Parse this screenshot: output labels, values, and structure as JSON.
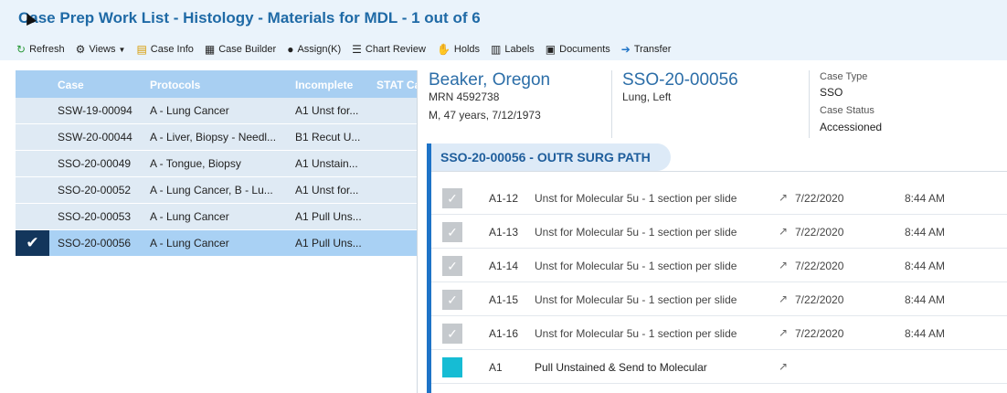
{
  "window": {
    "title": "Case Prep Work List - Histology - Materials for MDL - 1 out of 6"
  },
  "toolbar": {
    "items": [
      {
        "label": "Refresh",
        "icon": "refresh-icon"
      },
      {
        "label": "Views",
        "icon": "views-icon"
      },
      {
        "label": "Case Info",
        "icon": "case-info-icon"
      },
      {
        "label": "Case Builder",
        "icon": "case-builder-icon"
      },
      {
        "label": "Assign(K)",
        "icon": "assign-icon"
      },
      {
        "label": "Chart Review",
        "icon": "chart-review-icon"
      },
      {
        "label": "Holds",
        "icon": "holds-icon"
      },
      {
        "label": "Labels",
        "icon": "labels-icon"
      },
      {
        "label": "Documents",
        "icon": "documents-icon"
      },
      {
        "label": "Transfer",
        "icon": "transfer-arrow-icon"
      }
    ]
  },
  "worklist": {
    "columns": [
      "Case",
      "Protocols",
      "Incomplete",
      "STAT Ca"
    ],
    "rows": [
      {
        "case": "SSW-19-00094",
        "protocols": "A - Lung Cancer",
        "incomplete": "A1 Unst for...",
        "selected": false
      },
      {
        "case": "SSW-20-00044",
        "protocols": "A - Liver, Biopsy - Needl...",
        "incomplete": "B1 Recut U...",
        "selected": false
      },
      {
        "case": "SSO-20-00049",
        "protocols": "A - Tongue, Biopsy",
        "incomplete": "A1 Unstain...",
        "selected": false
      },
      {
        "case": "SSO-20-00052",
        "protocols": "A - Lung Cancer, B - Lu...",
        "incomplete": "A1 Unst for...",
        "selected": false
      },
      {
        "case": "SSO-20-00053",
        "protocols": "A - Lung Cancer",
        "incomplete": "A1 Pull Uns...",
        "selected": false
      },
      {
        "case": "SSO-20-00056",
        "protocols": "A - Lung Cancer",
        "incomplete": "A1 Pull Uns...",
        "selected": true
      }
    ]
  },
  "patient": {
    "name": "Beaker, Oregon",
    "mrn": "MRN 4592738",
    "demographics": "M, 47 years, 7/12/1973",
    "case_number": "SSO-20-00056",
    "site": "Lung, Left",
    "case_type_label": "Case Type",
    "case_type": "SSO",
    "case_status_label": "Case Status",
    "case_status": "Accessioned"
  },
  "section": {
    "title": "SSO-20-00056 - OUTR SURG PATH",
    "items": [
      {
        "code": "A1-12",
        "description": "Unst for Molecular 5u - 1 section per slide",
        "date": "7/22/2020",
        "time": "8:44 AM",
        "done": true
      },
      {
        "code": "A1-13",
        "description": "Unst for Molecular 5u - 1 section per slide",
        "date": "7/22/2020",
        "time": "8:44 AM",
        "done": true
      },
      {
        "code": "A1-14",
        "description": "Unst for Molecular 5u - 1 section per slide",
        "date": "7/22/2020",
        "time": "8:44 AM",
        "done": true
      },
      {
        "code": "A1-15",
        "description": "Unst for Molecular 5u - 1 section per slide",
        "date": "7/22/2020",
        "time": "8:44 AM",
        "done": true
      },
      {
        "code": "A1-16",
        "description": "Unst for Molecular 5u - 1 section per slide",
        "date": "7/22/2020",
        "time": "8:44 AM",
        "done": true
      },
      {
        "code": "A1",
        "description": "Pull Unstained & Send to Molecular",
        "date": "",
        "time": "",
        "done": false
      }
    ]
  },
  "colors": {
    "accent": "#1f6aa6",
    "header": "#a8cff2",
    "selected_row": "#a9d1f4",
    "row": "#dfeaf4",
    "teal": "#16bcd4"
  }
}
